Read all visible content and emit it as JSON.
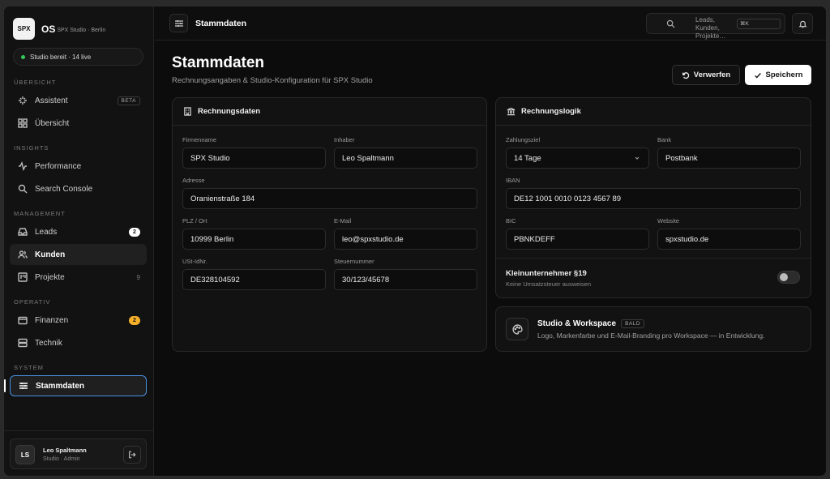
{
  "brand": {
    "logo": "SPX",
    "name": "OS",
    "sub": "SPX Studio · Berlin"
  },
  "status": {
    "text": "Studio bereit · 14 live",
    "color": "#34c759"
  },
  "sections": {
    "uebersicht": "Übersicht",
    "insights": "Insights",
    "management": "Management",
    "operativ": "Operativ",
    "system": "System"
  },
  "nav": {
    "assistent": {
      "label": "Assistent",
      "tag": "BETA",
      "icon": "sparkle-icon"
    },
    "uebersicht": {
      "label": "Übersicht",
      "icon": "grid-icon"
    },
    "performance": {
      "label": "Performance",
      "icon": "activity-icon"
    },
    "search_console": {
      "label": "Search Console",
      "icon": "search-icon"
    },
    "leads": {
      "label": "Leads",
      "count": "2",
      "icon": "inbox-icon"
    },
    "kunden": {
      "label": "Kunden",
      "icon": "users-icon"
    },
    "projekte": {
      "label": "Projekte",
      "count": "9",
      "icon": "kanban-icon"
    },
    "finanzen": {
      "label": "Finanzen",
      "count": "2",
      "icon": "wallet-icon"
    },
    "technik": {
      "label": "Technik",
      "icon": "server-icon"
    },
    "stammdaten": {
      "label": "Stammdaten",
      "icon": "sliders-icon"
    }
  },
  "user": {
    "initials": "LS",
    "name": "Leo Spaltmann",
    "role": "Studio · Admin"
  },
  "topbar": {
    "title": "Stammdaten",
    "search_placeholder": "Leads, Kunden, Projekte…",
    "shortcut": "⌘K"
  },
  "page": {
    "title": "Stammdaten",
    "subtitle": "Rechnungsangaben & Studio-Konfiguration für SPX Studio",
    "discard": "Verwerfen",
    "save": "Speichern"
  },
  "billing": {
    "title": "Rechnungsdaten",
    "fields": {
      "firma": {
        "label": "Firmenname",
        "value": "SPX Studio"
      },
      "inhaber": {
        "label": "Inhaber",
        "value": "Leo Spaltmann"
      },
      "adresse": {
        "label": "Adresse",
        "value": "Oranienstraße 184"
      },
      "plz": {
        "label": "PLZ / Ort",
        "value": "10999 Berlin"
      },
      "email": {
        "label": "E-Mail",
        "value": "leo@spxstudio.de"
      },
      "ustid": {
        "label": "USt-IdNr.",
        "value": "DE328104592"
      },
      "steuer": {
        "label": "Steuernummer",
        "value": "30/123/45678"
      }
    }
  },
  "logic": {
    "title": "Rechnungslogik",
    "fields": {
      "ziel": {
        "label": "Zahlungsziel",
        "value": "14 Tage"
      },
      "bank": {
        "label": "Bank",
        "value": "Postbank"
      },
      "iban": {
        "label": "IBAN",
        "value": "DE12 1001 0010 0123 4567 89"
      },
      "bic": {
        "label": "BIC",
        "value": "PBNKDEFF"
      },
      "website": {
        "label": "Website",
        "value": "spxstudio.de"
      }
    },
    "kleinunternehmer": {
      "title": "Kleinunternehmer §19",
      "subtitle": "Keine Umsatzsteuer ausweisen",
      "enabled": false
    }
  },
  "workspace": {
    "title": "Studio & Workspace",
    "tag": "BALD",
    "desc": "Logo, Markenfarbe und E-Mail-Branding pro Workspace — in Entwicklung."
  }
}
